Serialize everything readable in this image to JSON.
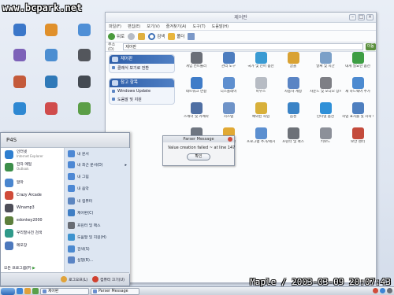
{
  "watermark": "www.bcpark.net",
  "signature": "Maple / 2003-03-09 20:07:43",
  "colors": {
    "desktop_bg": "#e3e9f3",
    "accent_blue": "#2e5ea8",
    "start_right_bg": "#dde6f2"
  },
  "desktop_icons": [
    {
      "label": "",
      "color": "#3b77c9",
      "icon": "recycle-bin-icon"
    },
    {
      "label": "",
      "color": "#e0902b",
      "icon": "bin-full-icon"
    },
    {
      "label": "",
      "color": "#4f8fd6",
      "icon": "globe-icon"
    },
    {
      "label": "",
      "color": "#7d62b8",
      "icon": "app-icon"
    },
    {
      "label": "",
      "color": "#4c8ed1",
      "icon": "network-icon"
    },
    {
      "label": "",
      "color": "#53565c",
      "icon": "media-icon"
    },
    {
      "label": "",
      "color": "#c45a3b",
      "icon": "game-icon"
    },
    {
      "label": "",
      "color": "#2f79b8",
      "icon": "drive-icon"
    },
    {
      "label": "",
      "color": "#444a52",
      "icon": "player-icon"
    },
    {
      "label": "",
      "color": "#2e88d2",
      "icon": "folder-icon"
    },
    {
      "label": "",
      "color": "#d04c4c",
      "icon": "tool-icon"
    },
    {
      "label": "",
      "color": "#5b9e47",
      "icon": "shortcut-icon"
    }
  ],
  "explorer": {
    "title": "제어판",
    "menu": [
      "파일(F)",
      "편집(E)",
      "보기(V)",
      "즐겨찾기(A)",
      "도구(T)",
      "도움말(H)"
    ],
    "toolbar": {
      "back": "뒤로",
      "search": "검색",
      "folders": "폴더"
    },
    "address_label": "주소(D)",
    "address": "제어판",
    "go": "이동",
    "task_panel_1": {
      "title": "제어판",
      "items": [
        "클래식 보기로 전환"
      ]
    },
    "task_panel_2": {
      "title": "참고 항목",
      "items": [
        "Windows Update",
        "도움말 및 지원"
      ]
    },
    "items": [
      {
        "label": "게임 컨트롤러",
        "color": "#6b6f78"
      },
      {
        "label": "관리 도구",
        "color": "#4d7dbf"
      },
      {
        "label": "국가 및 언어 옵션",
        "color": "#3a9bd3"
      },
      {
        "label": "글꼴",
        "color": "#d9a233"
      },
      {
        "label": "날짜 및 시간",
        "color": "#7ba0c8"
      },
      {
        "label": "내게 필요한 옵션",
        "color": "#3e9e44"
      },
      {
        "label": "네트워크 연결",
        "color": "#3f7cc8"
      },
      {
        "label": "디스플레이",
        "color": "#5e8fcf"
      },
      {
        "label": "마우스",
        "color": "#b7bcc4"
      },
      {
        "label": "사용자 계정",
        "color": "#5a84c4"
      },
      {
        "label": "사운드 및 오디오 장치",
        "color": "#7e7f85"
      },
      {
        "label": "새 하드웨어 추가",
        "color": "#4c8ad0"
      },
      {
        "label": "스캐너 및 카메라",
        "color": "#4f6fa3"
      },
      {
        "label": "시스템",
        "color": "#6e93c8"
      },
      {
        "label": "예약된 작업",
        "color": "#d8b03a"
      },
      {
        "label": "음성",
        "color": "#3a83c6"
      },
      {
        "label": "인터넷 옵션",
        "color": "#2f90d8"
      },
      {
        "label": "작업 표시줄 및 시작 메뉴",
        "color": "#4e7fbf"
      },
      {
        "label": "전화 및 모뎀 옵션",
        "color": "#6f7681"
      },
      {
        "label": "폴더 옵션",
        "color": "#e1a934"
      },
      {
        "label": "프로그램 추가/제거",
        "color": "#5b8fd0"
      },
      {
        "label": "프린터 및 팩스",
        "color": "#6d7178"
      },
      {
        "label": "키보드",
        "color": "#8c9099"
      },
      {
        "label": "보안 센터",
        "color": "#c44b3c"
      }
    ]
  },
  "dialog": {
    "title": "Parser Message",
    "message": "Value creation failed ~ at line 147",
    "ok": "확인"
  },
  "start_menu": {
    "user": "P4S",
    "left_items": [
      {
        "title": "인터넷",
        "sub": "Internet Explorer",
        "color": "#2f7fd0"
      },
      {
        "title": "전자 메일",
        "sub": "Outlook",
        "color": "#3c8e4a"
      },
      {
        "title": "알마",
        "sub": "",
        "color": "#4a86cf"
      },
      {
        "title": "Crazy Arcade",
        "sub": "",
        "color": "#d04c3a"
      },
      {
        "title": "Winamp3",
        "sub": "",
        "color": "#4e4e58"
      },
      {
        "title": "edonkey2000",
        "sub": "",
        "color": "#5d7f3c"
      },
      {
        "title": "우리말사전 검색",
        "sub": "",
        "color": "#2f9a8a"
      },
      {
        "title": "메모장",
        "sub": "",
        "color": "#4d79bd"
      }
    ],
    "all_programs": "모든 프로그램(P)",
    "right_items": [
      {
        "label": "내 문서",
        "color": "#4d88d4",
        "arrow": ""
      },
      {
        "label": "내 최근 문서(D)",
        "color": "#4d88d4",
        "arrow": "▸"
      },
      {
        "label": "내 그림",
        "color": "#4d88d4",
        "arrow": ""
      },
      {
        "label": "내 음악",
        "color": "#4d88d4",
        "arrow": ""
      },
      {
        "label": "내 컴퓨터",
        "color": "#5c86c0",
        "arrow": ""
      },
      {
        "label": "제어판(C)",
        "color": "#3f7ec4",
        "arrow": ""
      },
      {
        "label": "프린터 및 팩스",
        "color": "#686c74",
        "arrow": ""
      },
      {
        "label": "도움말 및 지원(H)",
        "color": "#3e93cf",
        "arrow": ""
      },
      {
        "label": "검색(S)",
        "color": "#4c8ad0",
        "arrow": ""
      },
      {
        "label": "실행(R)...",
        "color": "#5a84c4",
        "arrow": ""
      }
    ],
    "logoff": "로그오프(L)",
    "shutdown": "컴퓨터 끄기(U)"
  },
  "taskbar": {
    "quicklaunch": [
      "#3d85d6",
      "#e0a13a",
      "#5aa04a"
    ],
    "tasks": [
      "제어판",
      "Parser Message"
    ],
    "tray": [
      "#d04c3a",
      "#3d85d6",
      "#6a6f78"
    ]
  }
}
